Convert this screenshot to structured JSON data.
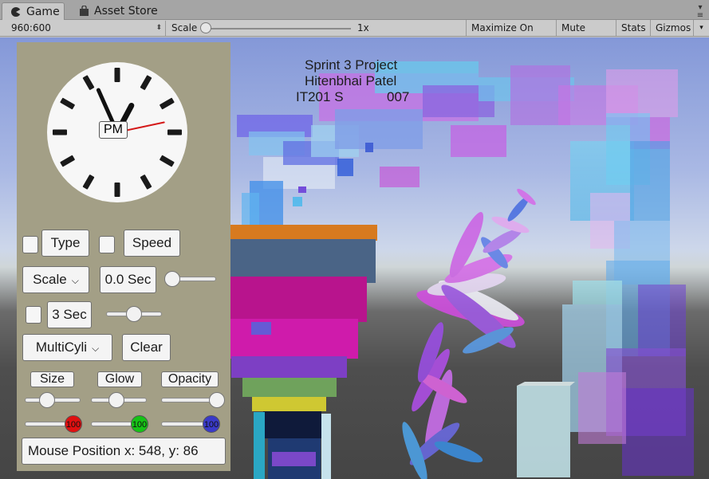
{
  "tabs": [
    {
      "label": "Game",
      "icon": "pacman-game-icon"
    },
    {
      "label": "Asset Store",
      "icon": "store-bag-icon"
    }
  ],
  "toolbar": {
    "resolution": "960:600",
    "scale_label": "Scale",
    "scale_value": "1x",
    "scale_fraction": 0.0,
    "maximize_label": "Maximize On Play",
    "mute_label": "Mute Audio",
    "stats_label": "Stats",
    "gizmos_label": "Gizmos"
  },
  "scene": {
    "title_lines": [
      "Sprint 3 Project",
      "Hitenbhai Patel",
      "IT201 S",
      "007"
    ]
  },
  "panel": {
    "clock": {
      "ampm": "PM",
      "hour": 12,
      "minute": 56,
      "second": 13
    },
    "type_label": "Type",
    "speed_label": "Speed",
    "scale_dropdown": "Scale",
    "seconds_value": "0.0 Sec",
    "three_sec_label": "3 Sec",
    "shape_dropdown": "MultiCyli",
    "clear_label": "Clear",
    "size_label": "Size",
    "glow_label": "Glow",
    "opacity_label": "Opacity",
    "size_fraction": 0.4,
    "glow_fraction": 0.45,
    "opacity_fraction": 1.0,
    "red_value": "100",
    "green_value": "100",
    "blue_value": "100",
    "colors": {
      "red": "#e01010",
      "green": "#16c316",
      "blue": "#3a3ac8"
    },
    "mouse_position": "Mouse Position x: 548, y: 86"
  }
}
